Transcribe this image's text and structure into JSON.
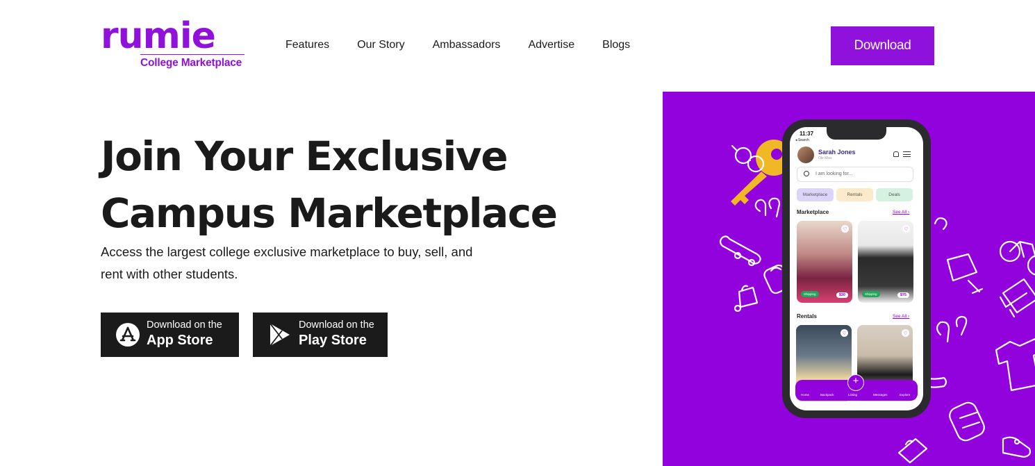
{
  "header": {
    "logo_word": "rumie",
    "logo_subtitle": "College Marketplace",
    "nav": [
      "Features",
      "Our Story",
      "Ambassadors",
      "Advertise",
      "Blogs"
    ],
    "download_label": "Download"
  },
  "hero": {
    "title_line1_prefix": "Join Your ",
    "title_line1_highlight": "Exclusive",
    "title_line2": "Campus Marketplace",
    "subtitle": "Access the largest college exclusive marketplace to buy, sell, and rent with other students.",
    "app_store": {
      "small": "Download on the",
      "big": "App Store"
    },
    "play_store": {
      "small": "Download on the",
      "big": "Play Store"
    }
  },
  "phone": {
    "time": "11:37",
    "back": "◂ Search",
    "user_name": "Sarah Jones",
    "user_sub": "Ole Miss",
    "search_placeholder": "I am looking for...",
    "chips": [
      "Marketplace",
      "Rentals",
      "Deals"
    ],
    "section_marketplace": "Marketplace",
    "section_rentals": "Rentals",
    "see_all": "See All ›",
    "badge_shipping": "Shipping",
    "price_1": "$30",
    "price_2": "$75",
    "bottom_nav": [
      "Home",
      "Backpack",
      "Listing",
      "Messages",
      "Explore"
    ]
  },
  "colors": {
    "brand": "#9010dc",
    "panel": "#9102dd",
    "dark_button": "#1b1b1b"
  }
}
